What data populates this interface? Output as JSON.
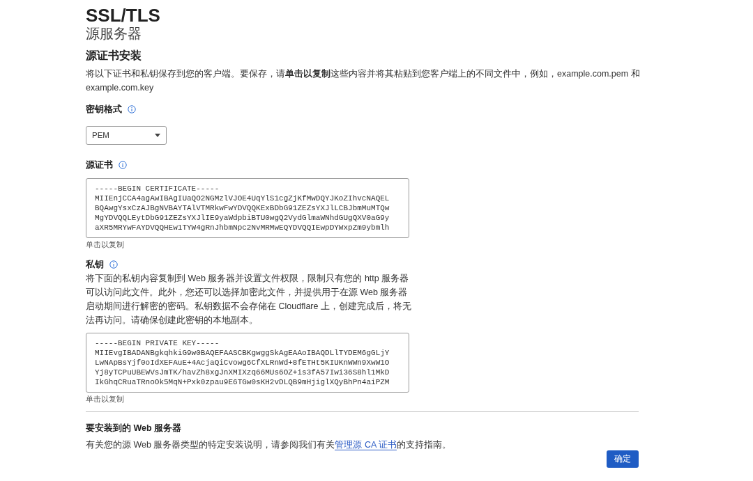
{
  "page": {
    "title": "SSL/TLS",
    "subtitle": "源服务器"
  },
  "section": {
    "heading": "源证书安装",
    "description": "将以下证书和私钥保存到您的客户端。要保存，请**单击以复制**这些内容并将其粘贴到您客户端上的不同文件中，例如，example.com.pem 和 example.com.key"
  },
  "key_format": {
    "label": "密钥格式",
    "value": "PEM"
  },
  "certificate": {
    "label": "源证书",
    "lines": [
      "-----BEGIN CERTIFICATE-----",
      "MIIEnjCCA4agAwIBAgIUaQO2NGMzlVJOE4UqYlS1cgZjKfMwDQYJKoZIhvcNAQEL",
      "BQAwgYsxCzAJBgNVBAYTAlVTMRkwFwYDVQQKExBDbG91ZEZsYXJlLCBJbmMuMTQw",
      "MgYDVQQLEytDbG91ZEZsYXJlIE9yaWdpbiBTU0wgQ2VydGlmaWNhdGUgQXV0aG9y",
      "aXR5MRYwFAYDVQQHEw1TYW4gRnJhbmNpc2NvMRMwEQYDVQQIEwpDYWxpZm9ybmlh"
    ],
    "copy_hint": "单击以复制"
  },
  "private_key": {
    "label": "私钥",
    "description": "将下面的私钥内容复制到 Web 服务器并设置文件权限，限制只有您的 http 服务器可以访问此文件。此外，您还可以选择加密此文件，并提供用于在源 Web 服务器启动期间进行解密的密码。私钥数据不会存储在 Cloudflare 上，创建完成后，将无法再访问。请确保创建此密钥的本地副本。",
    "lines": [
      "-----BEGIN PRIVATE KEY-----",
      "MIIEvgIBADANBgkqhkiG9w0BAQEFAASCBKgwggSkAgEAAoIBAQDLlTYDEM6gGLjY",
      "LwNApBsYjf0oIdXEFAuE+4AcjaQiCvowg6CfXLRnWd+8fETHt5KIUKnWWn9XwW1O",
      "Yj8yTCPuUBEWVsJmTK/havZh8xgJnXMIXzq66MUs6OZ+is3fA57Iwi36S8hl1MkD",
      "IkGhqCRuaTRnoOk5MqN+Pxk0zpau9E6TGw0sKH2vDLQB9mHjiglXQyBhPn4aiPZM"
    ],
    "copy_hint": "单击以复制"
  },
  "web_server": {
    "heading": "要安装到的 Web 服务器",
    "text_before": "有关您的源 Web 服务器类型的特定安装说明，请参阅我们有关",
    "link": "管理源 CA 证书",
    "text_after": "的支持指南。"
  },
  "buttons": [
    "确定"
  ]
}
